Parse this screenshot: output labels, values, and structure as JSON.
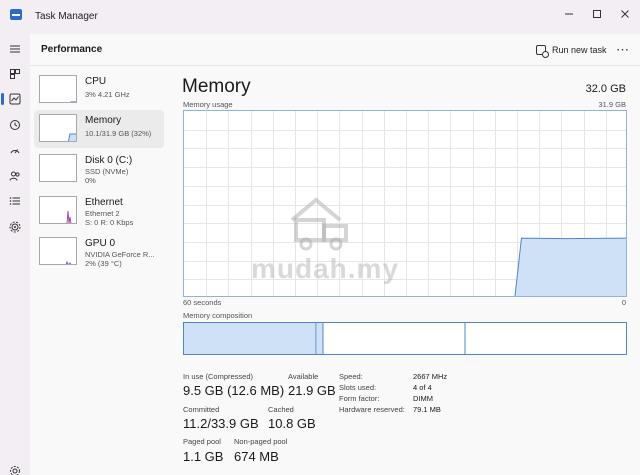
{
  "window": {
    "title": "Task Manager",
    "controls": [
      "minimize-icon",
      "maximize-icon",
      "close-icon"
    ]
  },
  "rail": {
    "items": [
      {
        "icon": "hamburger-menu-icon",
        "active": false
      },
      {
        "icon": "processes-icon",
        "active": false
      },
      {
        "icon": "performance-icon",
        "active": true
      },
      {
        "icon": "app-history-icon",
        "active": false
      },
      {
        "icon": "startup-apps-icon",
        "active": false
      },
      {
        "icon": "users-icon",
        "active": false
      },
      {
        "icon": "details-icon",
        "active": false
      },
      {
        "icon": "services-icon",
        "active": false
      },
      {
        "icon": "settings-icon",
        "active": false
      }
    ]
  },
  "header": {
    "title": "Performance",
    "run_new_task": "Run new task",
    "more": "⋯"
  },
  "sidebar": {
    "devices": [
      {
        "name": "CPU",
        "lines": [
          "3%  4.21 GHz"
        ],
        "selected": false
      },
      {
        "name": "Memory",
        "lines": [
          "10.1/31.9 GB (32%)"
        ],
        "selected": true
      },
      {
        "name": "Disk 0 (C:)",
        "lines": [
          "SSD (NVMe)",
          "0%"
        ],
        "selected": false
      },
      {
        "name": "Ethernet",
        "lines": [
          "Ethernet 2",
          "S: 0  R: 0 Kbps"
        ],
        "selected": false
      },
      {
        "name": "GPU 0",
        "lines": [
          "NVIDIA GeForce R...",
          "2%  (39 °C)"
        ],
        "selected": false
      }
    ]
  },
  "memory": {
    "title": "Memory",
    "total": "32.0 GB",
    "usage_label": "Memory usage",
    "usage_max": "31.9 GB",
    "time_label": "60 seconds",
    "time_end": "0",
    "composition_label": "Memory composition",
    "usage_level_fraction": 0.32,
    "stats": {
      "in_use_label": "In use (Compressed)",
      "in_use_value": "9.5 GB (12.6 MB)",
      "available_label": "Available",
      "available_value": "21.9 GB",
      "committed_label": "Committed",
      "committed_value": "11.2/33.9 GB",
      "cached_label": "Cached",
      "cached_value": "10.8 GB",
      "paged_label": "Paged pool",
      "paged_value": "1.1 GB",
      "nonpaged_label": "Non-paged pool",
      "nonpaged_value": "674 MB"
    },
    "details": {
      "speed_label": "Speed:",
      "speed_value": "2667 MHz",
      "slots_label": "Slots used:",
      "slots_value": "4 of 4",
      "form_label": "Form factor:",
      "form_value": "DIMM",
      "reserved_label": "Hardware reserved:",
      "reserved_value": "79.1 MB"
    }
  },
  "watermark": {
    "text": "mudah.my"
  },
  "colors": {
    "accent": "#2b6cc4",
    "memory_line": "#4d87c7",
    "memory_fill": "#cfe1f7",
    "ethernet_line": "#a54ba8",
    "gpu_line": "#8e5fc0"
  }
}
